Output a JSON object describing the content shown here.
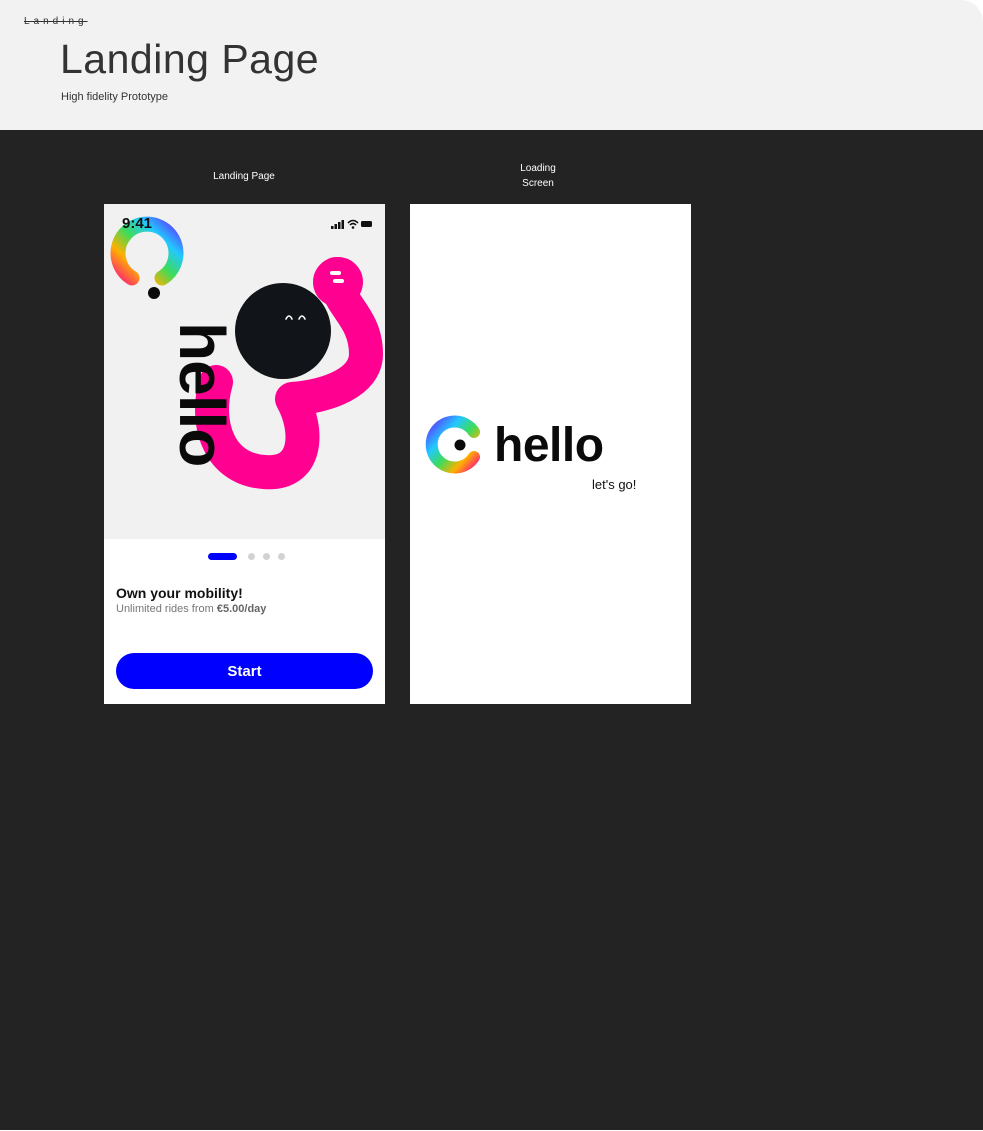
{
  "header": {
    "section_tag": "Landing",
    "title": "Landing Page",
    "subtitle": "High fidelity Prototype"
  },
  "frames": {
    "landing_label": "Landing Page",
    "loading_label_line1": "Loading",
    "loading_label_line2": "Screen"
  },
  "landing": {
    "status_time": "9:41",
    "brand_word": "hello",
    "pager": {
      "count": 4,
      "active_index": 0
    },
    "headline": "Own your mobility!",
    "sub_prefix": "Unlimited rides from ",
    "sub_price": "€5.00/day",
    "start_label": "Start"
  },
  "loading": {
    "brand_word": "hello",
    "tagline": "let's go!"
  },
  "colors": {
    "accent_blue": "#0000ff",
    "brand_pink": "#ff0090",
    "canvas_dark": "#232323",
    "header_bg": "#f2f2f2"
  },
  "icons": [
    "signal-icon",
    "wifi-icon",
    "battery-icon",
    "hello-logo-icon"
  ]
}
